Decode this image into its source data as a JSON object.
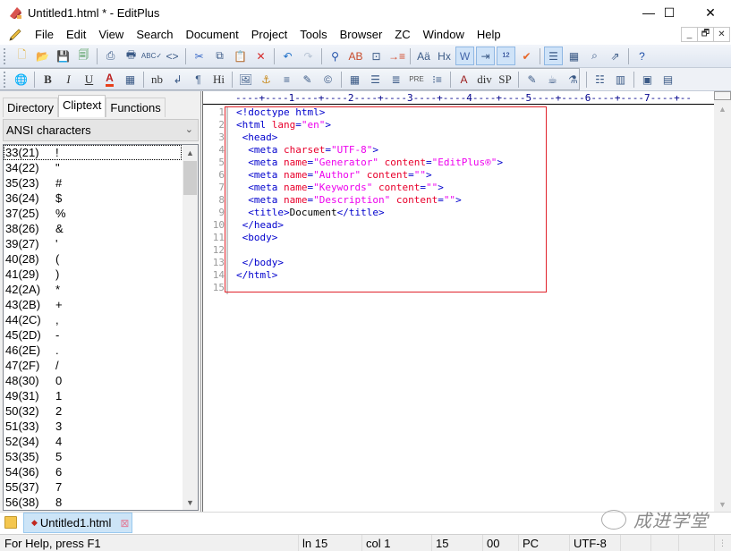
{
  "window": {
    "title": "Untitled1.html * - EditPlus",
    "minimize_glyph": "—",
    "maximize_glyph": "☐",
    "close_glyph": "✕"
  },
  "menubar": {
    "items": [
      "File",
      "Edit",
      "View",
      "Search",
      "Document",
      "Project",
      "Tools",
      "Browser",
      "ZC",
      "Window",
      "Help"
    ],
    "mdi_buttons": [
      "_",
      "🗗",
      "✕"
    ]
  },
  "toolbar1": {
    "buttons": [
      {
        "name": "new-file",
        "glyph": "🗋"
      },
      {
        "name": "open-file",
        "glyph": "📂"
      },
      {
        "name": "save",
        "glyph": "💾"
      },
      {
        "name": "save-all",
        "glyph": "🗐"
      },
      {
        "sep": true
      },
      {
        "name": "print-preview",
        "glyph": "⎙"
      },
      {
        "name": "print",
        "glyph": "🖶"
      },
      {
        "name": "spell-check",
        "glyph": "ABC✓"
      },
      {
        "name": "view-in-browser",
        "glyph": "<>"
      },
      {
        "sep": true
      },
      {
        "name": "cut",
        "glyph": "✂"
      },
      {
        "name": "copy",
        "glyph": "⧉"
      },
      {
        "name": "paste",
        "glyph": "📋"
      },
      {
        "name": "delete",
        "glyph": "✕"
      },
      {
        "sep": true
      },
      {
        "name": "undo",
        "glyph": "↶"
      },
      {
        "name": "redo",
        "glyph": "↷"
      },
      {
        "sep": true
      },
      {
        "name": "find",
        "glyph": "⚲"
      },
      {
        "name": "replace",
        "glyph": "AB"
      },
      {
        "name": "find-in-files",
        "glyph": "⊡"
      },
      {
        "name": "goto-line",
        "glyph": "→≡"
      },
      {
        "sep": true
      },
      {
        "name": "font",
        "glyph": "Aä"
      },
      {
        "name": "hex-viewer",
        "glyph": "Hx"
      },
      {
        "name": "word-wrap",
        "glyph": "W",
        "active": true
      },
      {
        "name": "indent",
        "glyph": "⇥",
        "active": true
      },
      {
        "name": "line-numbers",
        "glyph": "¹²",
        "active": true
      },
      {
        "name": "check-mark",
        "glyph": "✔"
      },
      {
        "sep": true
      },
      {
        "name": "cliptext-window",
        "glyph": "☰",
        "active": true
      },
      {
        "name": "output-window",
        "glyph": "▦"
      },
      {
        "name": "directory-window",
        "glyph": "⌕"
      },
      {
        "name": "fullscreen",
        "glyph": "⇗"
      },
      {
        "sep": true
      },
      {
        "name": "help",
        "glyph": "?"
      }
    ]
  },
  "toolbar2": {
    "buttons": [
      {
        "name": "browser",
        "glyph": "🌐"
      },
      {
        "sep": true
      },
      {
        "name": "bold",
        "glyph": "B"
      },
      {
        "name": "italic",
        "glyph": "I"
      },
      {
        "name": "underline",
        "glyph": "U"
      },
      {
        "name": "font-color",
        "glyph": "A"
      },
      {
        "name": "color-picker",
        "glyph": "▦"
      },
      {
        "sep": true
      },
      {
        "name": "nbsp",
        "glyph": "nb"
      },
      {
        "name": "line-break",
        "glyph": "↲"
      },
      {
        "name": "paragraph",
        "glyph": "¶"
      },
      {
        "name": "heading",
        "glyph": "Hi"
      },
      {
        "sep": true
      },
      {
        "name": "image",
        "glyph": "🖼"
      },
      {
        "name": "anchor",
        "glyph": "⚓"
      },
      {
        "name": "horizontal-rule",
        "glyph": "≡"
      },
      {
        "name": "comment",
        "glyph": "✎"
      },
      {
        "name": "special-char",
        "glyph": "©"
      },
      {
        "sep": true
      },
      {
        "name": "table",
        "glyph": "▦"
      },
      {
        "name": "center",
        "glyph": "☰"
      },
      {
        "name": "align",
        "glyph": "≣"
      },
      {
        "name": "pre",
        "glyph": "PRE"
      },
      {
        "name": "list",
        "glyph": "⁝≡"
      },
      {
        "sep": true
      },
      {
        "name": "form",
        "glyph": "A"
      },
      {
        "name": "div",
        "glyph": "div"
      },
      {
        "name": "span",
        "glyph": "SP"
      },
      {
        "sep": true
      },
      {
        "name": "edit-style",
        "glyph": "✎"
      },
      {
        "name": "style",
        "glyph": "☕"
      },
      {
        "name": "script",
        "glyph": "⚗"
      },
      {
        "sep": true
      },
      {
        "name": "frame",
        "glyph": "☷"
      },
      {
        "name": "layout",
        "glyph": "▥"
      },
      {
        "sep": true
      },
      {
        "name": "color-tool",
        "glyph": "▣"
      },
      {
        "name": "window-layout",
        "glyph": "▤"
      }
    ]
  },
  "sidebar": {
    "tabs": [
      {
        "label": "Directory",
        "active": false
      },
      {
        "label": "Cliptext",
        "active": true
      },
      {
        "label": "Functions",
        "active": false
      }
    ],
    "dropdown_value": "ANSI characters",
    "items": [
      {
        "code": "33(21)",
        "char": "!"
      },
      {
        "code": "34(22)",
        "char": "\""
      },
      {
        "code": "35(23)",
        "char": "#"
      },
      {
        "code": "36(24)",
        "char": "$"
      },
      {
        "code": "37(25)",
        "char": "%"
      },
      {
        "code": "38(26)",
        "char": "&"
      },
      {
        "code": "39(27)",
        "char": "'"
      },
      {
        "code": "40(28)",
        "char": "("
      },
      {
        "code": "41(29)",
        "char": ")"
      },
      {
        "code": "42(2A)",
        "char": "*"
      },
      {
        "code": "43(2B)",
        "char": "+"
      },
      {
        "code": "44(2C)",
        "char": ","
      },
      {
        "code": "45(2D)",
        "char": "-"
      },
      {
        "code": "46(2E)",
        "char": "."
      },
      {
        "code": "47(2F)",
        "char": "/"
      },
      {
        "code": "48(30)",
        "char": "0"
      },
      {
        "code": "49(31)",
        "char": "1"
      },
      {
        "code": "50(32)",
        "char": "2"
      },
      {
        "code": "51(33)",
        "char": "3"
      },
      {
        "code": "52(34)",
        "char": "4"
      },
      {
        "code": "53(35)",
        "char": "5"
      },
      {
        "code": "54(36)",
        "char": "6"
      },
      {
        "code": "55(37)",
        "char": "7"
      },
      {
        "code": "56(38)",
        "char": "8"
      }
    ]
  },
  "editor": {
    "ruler": "----+----1----+----2----+----3----+----4----+----5----+----6----+----7----+--",
    "lines": [
      [
        {
          "t": "tag",
          "s": "<!doctype html>"
        }
      ],
      [
        {
          "t": "tag",
          "s": "<html "
        },
        {
          "t": "attr",
          "s": "lang"
        },
        {
          "t": "tag",
          "s": "="
        },
        {
          "t": "val",
          "s": "\"en\""
        },
        {
          "t": "tag",
          "s": ">"
        }
      ],
      [
        {
          "t": "tag",
          "s": " <head>"
        }
      ],
      [
        {
          "t": "tag",
          "s": "  <meta "
        },
        {
          "t": "attr",
          "s": "charset"
        },
        {
          "t": "tag",
          "s": "="
        },
        {
          "t": "val",
          "s": "\"UTF-8\""
        },
        {
          "t": "tag",
          "s": ">"
        }
      ],
      [
        {
          "t": "tag",
          "s": "  <meta "
        },
        {
          "t": "attr",
          "s": "name"
        },
        {
          "t": "tag",
          "s": "="
        },
        {
          "t": "val",
          "s": "\"Generator\""
        },
        {
          "t": "tag",
          "s": " "
        },
        {
          "t": "attr",
          "s": "content"
        },
        {
          "t": "tag",
          "s": "="
        },
        {
          "t": "val",
          "s": "\"EditPlus®\""
        },
        {
          "t": "tag",
          "s": ">"
        }
      ],
      [
        {
          "t": "tag",
          "s": "  <meta "
        },
        {
          "t": "attr",
          "s": "name"
        },
        {
          "t": "tag",
          "s": "="
        },
        {
          "t": "val",
          "s": "\"Author\""
        },
        {
          "t": "tag",
          "s": " "
        },
        {
          "t": "attr",
          "s": "content"
        },
        {
          "t": "tag",
          "s": "="
        },
        {
          "t": "val",
          "s": "\"\""
        },
        {
          "t": "tag",
          "s": ">"
        }
      ],
      [
        {
          "t": "tag",
          "s": "  <meta "
        },
        {
          "t": "attr",
          "s": "name"
        },
        {
          "t": "tag",
          "s": "="
        },
        {
          "t": "val",
          "s": "\"Keywords\""
        },
        {
          "t": "tag",
          "s": " "
        },
        {
          "t": "attr",
          "s": "content"
        },
        {
          "t": "tag",
          "s": "="
        },
        {
          "t": "val",
          "s": "\"\""
        },
        {
          "t": "tag",
          "s": ">"
        }
      ],
      [
        {
          "t": "tag",
          "s": "  <meta "
        },
        {
          "t": "attr",
          "s": "name"
        },
        {
          "t": "tag",
          "s": "="
        },
        {
          "t": "val",
          "s": "\"Description\""
        },
        {
          "t": "tag",
          "s": " "
        },
        {
          "t": "attr",
          "s": "content"
        },
        {
          "t": "tag",
          "s": "="
        },
        {
          "t": "val",
          "s": "\"\""
        },
        {
          "t": "tag",
          "s": ">"
        }
      ],
      [
        {
          "t": "tag",
          "s": "  <title>"
        },
        {
          "t": "txt",
          "s": "Document"
        },
        {
          "t": "tag",
          "s": "</title>"
        }
      ],
      [
        {
          "t": "tag",
          "s": " </head>"
        }
      ],
      [
        {
          "t": "tag",
          "s": " <body>"
        }
      ],
      [],
      [
        {
          "t": "tag",
          "s": " </body>"
        }
      ],
      [
        {
          "t": "tag",
          "s": "</html>"
        }
      ],
      []
    ]
  },
  "doctabs": {
    "active_tab": "Untitled1.html",
    "close_glyph": "⊠"
  },
  "watermark": {
    "text": "成进学堂"
  },
  "statusbar": {
    "help": "For Help, press F1",
    "line": "ln 15",
    "col": "col 1",
    "total_lines": "15",
    "char_code": "00",
    "line_ending": "PC",
    "encoding": "UTF-8"
  },
  "colors": {
    "tag": "#0000cd",
    "attribute": "#e8002c",
    "value": "#ee00ee",
    "highlight_box": "#e0222a",
    "active_tab_bg": "#cce4f7"
  }
}
